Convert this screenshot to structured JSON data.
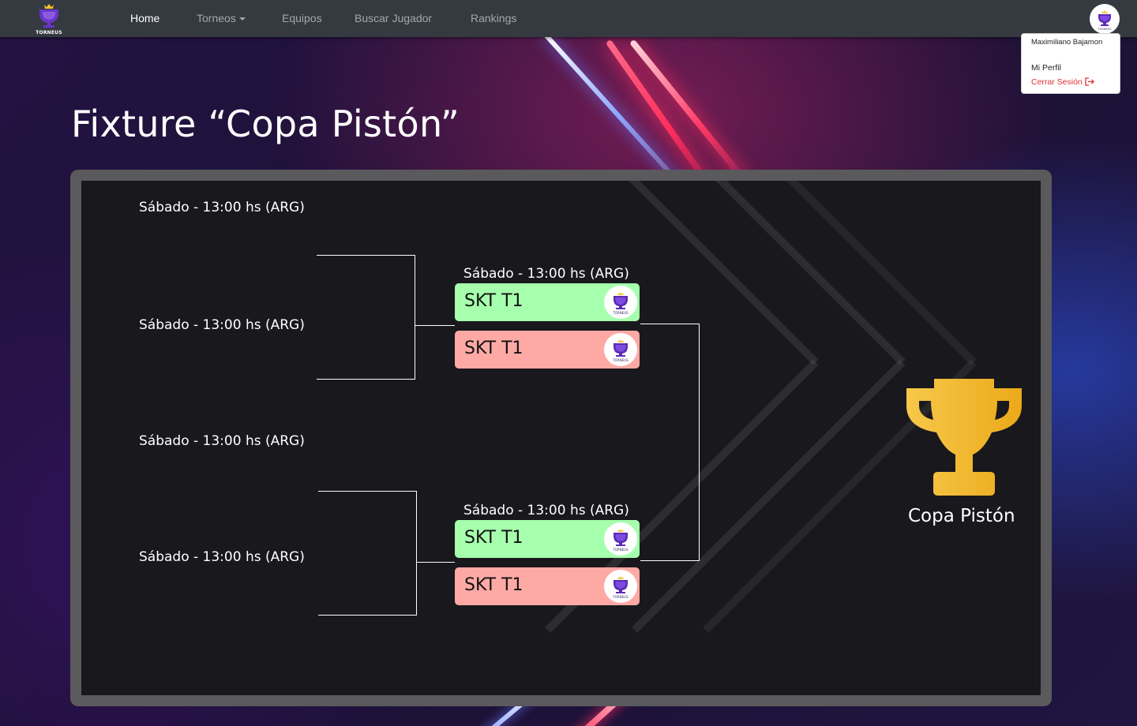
{
  "navbar": {
    "brand": "TORNEUS",
    "items": [
      {
        "label": "Home",
        "active": true
      },
      {
        "label": "Torneos",
        "dropdown": true
      },
      {
        "label": "Equipos"
      },
      {
        "label": "Buscar Jugador"
      },
      {
        "label": "Rankings"
      }
    ],
    "user_menu": {
      "user_name": "Maximiliano Bajamon",
      "profile": "Mi Perfil",
      "logout": "Cerrar Sesión"
    }
  },
  "page": {
    "title": "Fixture “Copa Pistón”"
  },
  "bracket": {
    "round1": [
      {
        "time": "Sábado - 13:00 hs (ARG)"
      },
      {
        "time": "Sábado - 13:00 hs (ARG)"
      },
      {
        "time": "Sábado - 13:00 hs (ARG)"
      },
      {
        "time": "Sábado - 13:00 hs (ARG)"
      }
    ],
    "round2": [
      {
        "time": "Sábado - 13:00 hs (ARG)",
        "teams": [
          {
            "name": "SKT T1",
            "result": "win",
            "logo": "TORNEUS"
          },
          {
            "name": "SKT T1",
            "result": "lose",
            "logo": "TORNEUS"
          }
        ]
      },
      {
        "time": "Sábado - 13:00 hs (ARG)",
        "teams": [
          {
            "name": "SKT T1",
            "result": "win",
            "logo": "TORNEUS"
          },
          {
            "name": "SKT T1",
            "result": "lose",
            "logo": "TORNEUS"
          }
        ]
      }
    ],
    "final": {
      "label": "Copa Pistón",
      "icon": "trophy-icon"
    }
  },
  "colors": {
    "navbar": "#343a40",
    "win": "#a6ffad",
    "lose": "#ffa9a5",
    "trophy": "#f1b01e",
    "logout": "#e03131",
    "brand_purple": "#5b2bb5"
  }
}
